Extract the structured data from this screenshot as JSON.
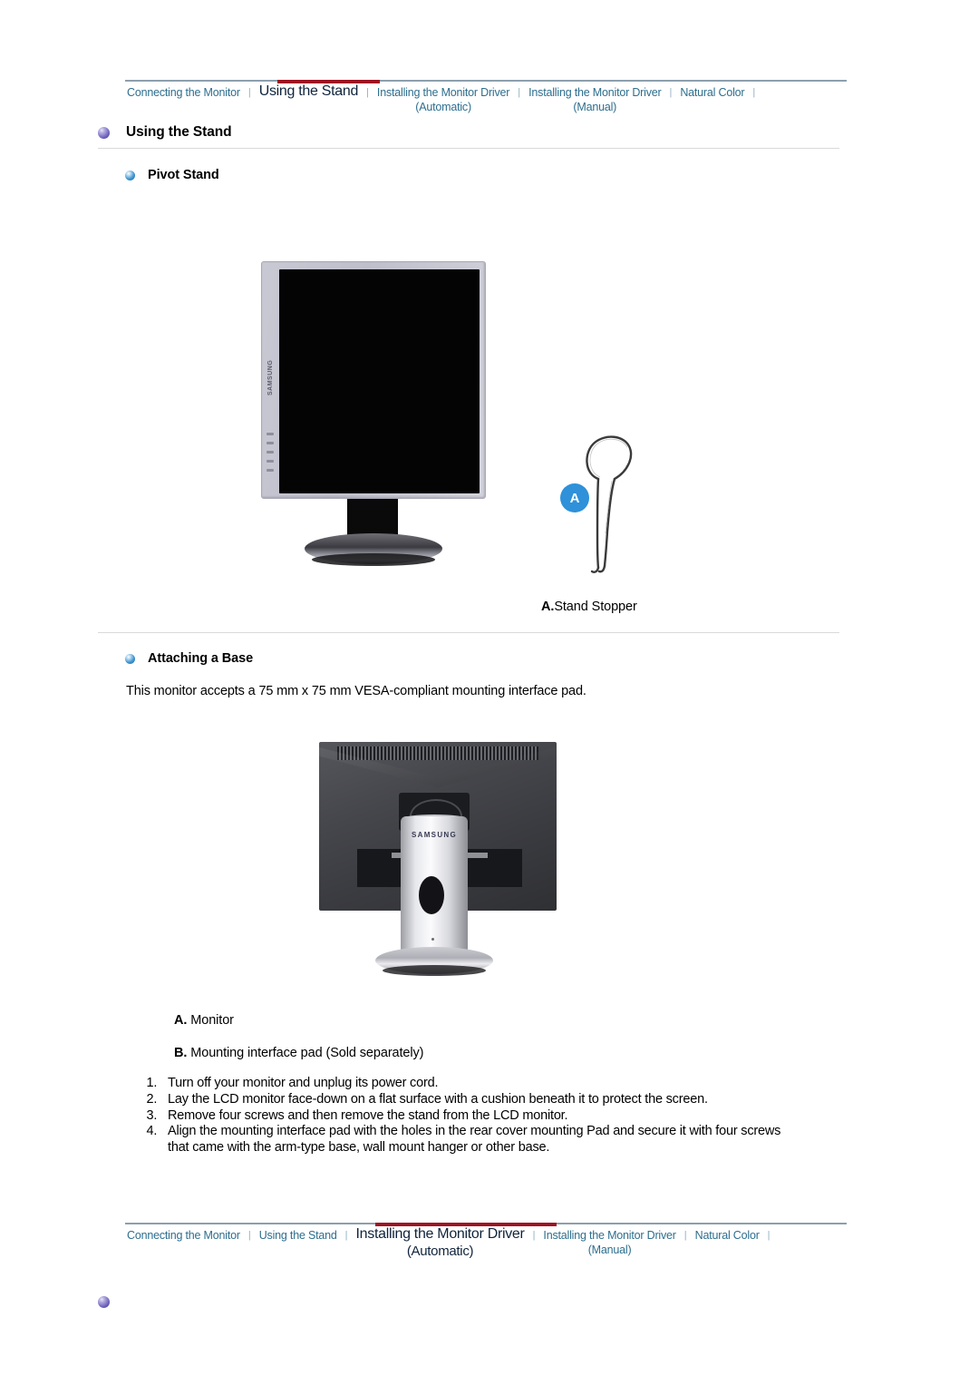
{
  "nav": {
    "top": {
      "items": [
        {
          "label": "Connecting the Monitor",
          "sub": "",
          "active": false
        },
        {
          "label": "Using the Stand",
          "sub": "",
          "active": true
        },
        {
          "label": "Installing the Monitor Driver",
          "sub": "(Automatic)",
          "active": false
        },
        {
          "label": "Installing the Monitor Driver",
          "sub": "(Manual)",
          "active": false
        },
        {
          "label": "Natural Color",
          "sub": "",
          "active": false
        }
      ],
      "separator": "|"
    },
    "bottom": {
      "items": [
        {
          "label": "Connecting the Monitor",
          "sub": "",
          "active": false
        },
        {
          "label": "Using the Stand",
          "sub": "",
          "active": false
        },
        {
          "label": "Installing the Monitor Driver",
          "sub": "(Automatic)",
          "active": true
        },
        {
          "label": "Installing the Monitor Driver",
          "sub": "(Manual)",
          "active": false
        },
        {
          "label": "Natural Color",
          "sub": "",
          "active": false
        }
      ],
      "separator": "|"
    },
    "accent_color": "#9c1322",
    "link_color": "#2d6e8e",
    "active_color": "#10243c"
  },
  "page": {
    "title": "Using the Stand",
    "sections": [
      {
        "heading": "Pivot Stand"
      },
      {
        "heading": "Attaching a Base"
      }
    ],
    "vesa_text": "This monitor accepts a 75 mm x 75 mm VESA-compliant mounting interface pad."
  },
  "figures": {
    "pivot_monitor": {
      "brand": "SAMSUNG"
    },
    "stand_stopper": {
      "badge": "A",
      "badge_color": "#2e91d9",
      "caption_label": "A.",
      "caption_text": "Stand Stopper"
    },
    "rear_monitor": {
      "brand": "SAMSUNG"
    }
  },
  "legend": {
    "a_label": "A.",
    "a_text": "Monitor",
    "b_label": "B.",
    "b_text": "Mounting interface pad (Sold separately)"
  },
  "steps": [
    "Turn off your monitor and unplug its power cord.",
    "Lay the LCD monitor face-down on a flat surface with a cushion beneath it to protect the screen.",
    "Remove four screws and then remove the stand from the LCD monitor.",
    "Align the mounting interface pad with the holes in the rear cover mounting Pad and secure it with four screws that came with the arm-type base, wall mount hanger or other base."
  ]
}
